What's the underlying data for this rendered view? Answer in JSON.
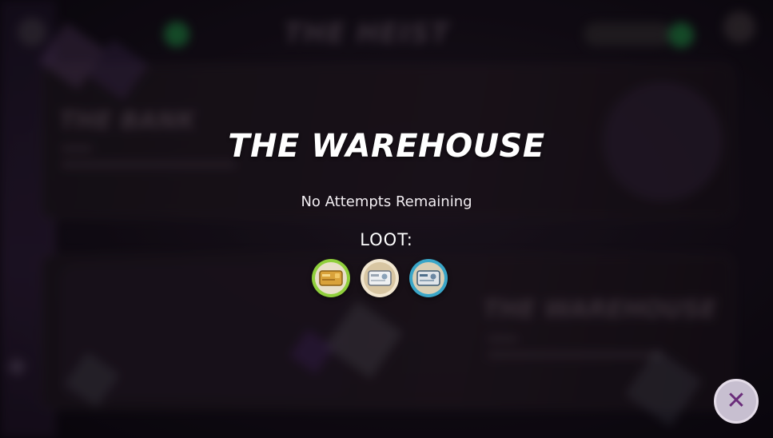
{
  "background": {
    "header_title": "THE HEIST",
    "card_top_title": "THE BANK",
    "card_bottom_title": "THE WAREHOUSE"
  },
  "modal": {
    "title": "THE WAREHOUSE",
    "status": "No Attempts Remaining",
    "loot_label": "LOOT:",
    "loot": [
      {
        "icon": "gold-keycard-icon",
        "ring_color": "#8fcf3c"
      },
      {
        "icon": "silver-keycard-icon",
        "ring_color": "#f1e6cf"
      },
      {
        "icon": "blue-keycard-icon",
        "ring_color": "#3aa6c8"
      }
    ]
  },
  "close_button": {
    "icon": "close-icon",
    "glyph": "✕"
  },
  "colors": {
    "accent_purple": "#6a2c7a",
    "close_bg": "#c7bfd0"
  }
}
